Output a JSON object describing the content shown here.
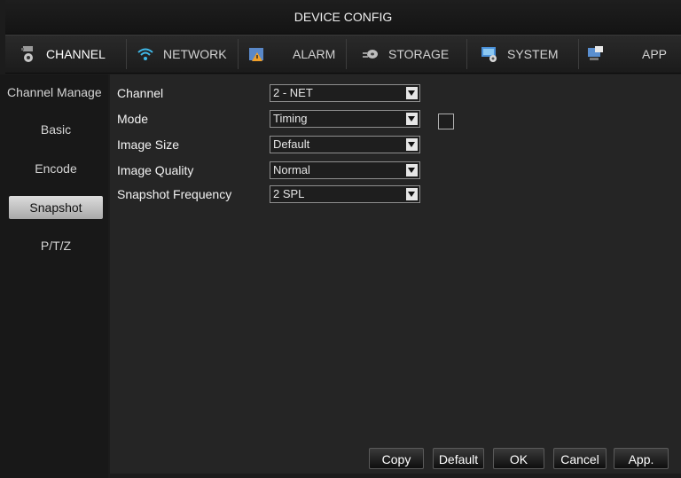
{
  "window": {
    "title": "DEVICE CONFIG"
  },
  "tabs": [
    {
      "label": "CHANNEL",
      "icon": "channel-icon",
      "active": true
    },
    {
      "label": "NETWORK",
      "icon": "wifi-icon"
    },
    {
      "label": "ALARM",
      "icon": "alarm-icon"
    },
    {
      "label": "STORAGE",
      "icon": "storage-icon"
    },
    {
      "label": "SYSTEM",
      "icon": "system-icon"
    },
    {
      "label": "APP",
      "icon": "app-icon"
    }
  ],
  "sidebar": {
    "items": [
      {
        "label": "Channel Manage"
      },
      {
        "label": "Basic"
      },
      {
        "label": "Encode"
      },
      {
        "label": "Snapshot",
        "active": true
      },
      {
        "label": "P/T/Z"
      }
    ]
  },
  "form": {
    "channel": {
      "label": "Channel",
      "value": "2 - NET"
    },
    "mode": {
      "label": "Mode",
      "value": "Timing",
      "checkbox_checked": false
    },
    "image_size": {
      "label": "Image Size",
      "value": "Default"
    },
    "image_quality": {
      "label": "Image Quality",
      "value": "Normal"
    },
    "snapshot_frequency": {
      "label": "Snapshot Frequency",
      "value": "2 SPL"
    }
  },
  "buttons": {
    "copy": "Copy",
    "default": "Default",
    "ok": "OK",
    "cancel": "Cancel",
    "apply": "App."
  },
  "colors": {
    "background": "#1c1c1c",
    "panel": "#252525",
    "active_tab_bg": "#c8c8c8"
  }
}
